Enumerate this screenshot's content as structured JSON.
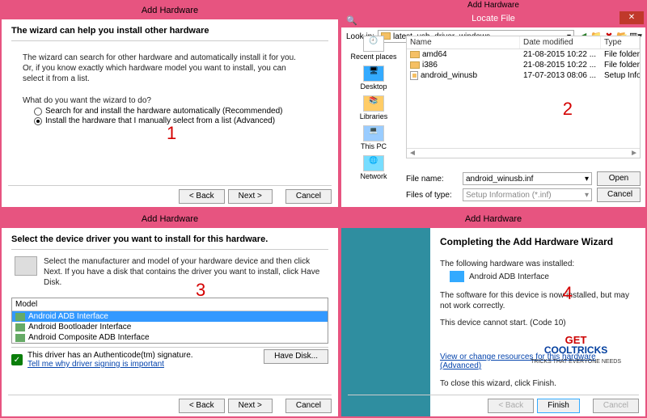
{
  "p1": {
    "title": "Add Hardware",
    "heading": "The wizard can help you install other hardware",
    "desc": "The wizard can search for other hardware and automatically install it for you. Or, if you know exactly which hardware model you want to install, you can select it from a list.",
    "prompt": "What do you want the wizard to do?",
    "opt1": "Search for and install the hardware automatically (Recommended)",
    "opt2": "Install the hardware that I manually select from a list (Advanced)",
    "back": "< Back",
    "next": "Next >",
    "cancel": "Cancel",
    "step": "1"
  },
  "p2": {
    "pretitle": "Add Hardware",
    "title": "Locate File",
    "lookin_lbl": "Look in:",
    "lookin_val": "latest_usb_driver_windows",
    "cols": {
      "name": "Name",
      "date": "Date modified",
      "type": "Type"
    },
    "rows": [
      {
        "name": "amd64",
        "date": "21-08-2015 10:22 ...",
        "type": "File folder",
        "kind": "folder"
      },
      {
        "name": "i386",
        "date": "21-08-2015 10:22 ...",
        "type": "File folder",
        "kind": "folder"
      },
      {
        "name": "android_winusb",
        "date": "17-07-2013 08:06 ...",
        "type": "Setup Info",
        "kind": "inf"
      }
    ],
    "places": [
      "Recent places",
      "Desktop",
      "Libraries",
      "This PC",
      "Network"
    ],
    "filename_lbl": "File name:",
    "filename_val": "android_winusb.inf",
    "filter_lbl": "Files of type:",
    "filter_val": "Setup Information (*.inf)",
    "open": "Open",
    "cancel": "Cancel",
    "step": "2"
  },
  "p3": {
    "title": "Add Hardware",
    "heading": "Select the device driver you want to install for this hardware.",
    "desc": "Select the manufacturer and model of your hardware device and then click Next. If you have a disk that contains the driver you want to install, click Have Disk.",
    "model_hdr": "Model",
    "models": [
      "Android ADB Interface",
      "Android Bootloader Interface",
      "Android Composite ADB Interface"
    ],
    "auth": "This driver has an Authenticode(tm) signature.",
    "tell": "Tell me why driver signing is important",
    "havedisk": "Have Disk...",
    "back": "< Back",
    "next": "Next >",
    "cancel": "Cancel",
    "step": "3"
  },
  "p4": {
    "title": "Add Hardware",
    "heading": "Completing the Add Hardware Wizard",
    "installed": "The following hardware was installed:",
    "device": "Android ADB Interface",
    "note": "The software for this device is now installed, but may not work correctly.",
    "err": "This device cannot start. (Code 10)",
    "link": "View or change resources for this hardware (Advanced)",
    "close": "To close this wizard, click Finish.",
    "back": "< Back",
    "finish": "Finish",
    "cancel": "Cancel",
    "step": "4",
    "logo_get": "GET",
    "logo_main": "OOLTRICKS",
    "logo_tag": "TRICKS THAT EVERYONE NEEDS"
  }
}
